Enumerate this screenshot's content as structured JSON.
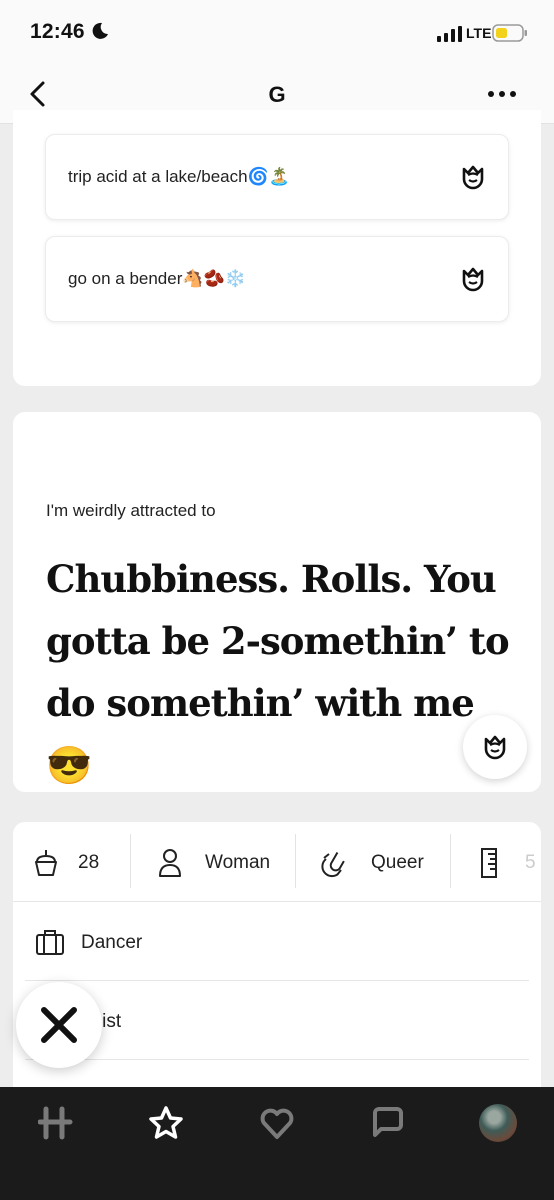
{
  "status_bar": {
    "time": "12:46",
    "network": "LTE"
  },
  "header": {
    "title": "G"
  },
  "answers": [
    {
      "text": "trip acid at a lake/beach🌀🏝️"
    },
    {
      "text": "go on a bender🐴🫘❄️"
    }
  ],
  "prompt": {
    "question": "I'm weirdly attracted to",
    "answer": "Chubbiness. Rolls. You gotta be 2-somethin’ to do somethin’ with me😎"
  },
  "vitals": [
    {
      "icon": "cupcake-icon",
      "label": "28"
    },
    {
      "icon": "person-icon",
      "label": "Woman"
    },
    {
      "icon": "magnet-icon",
      "label": "Queer"
    },
    {
      "icon": "ruler-icon",
      "label": "5"
    }
  ],
  "details": [
    {
      "icon": "briefcase-icon",
      "label": "Dancer"
    },
    {
      "icon": "religion-icon",
      "label": "heist"
    }
  ],
  "nav": [
    "hinge-logo-icon",
    "star-icon",
    "heart-icon",
    "chat-icon",
    "profile-avatar"
  ],
  "colors": {
    "background": "#ededed",
    "card": "#ffffff",
    "nav": "#1b1b1b",
    "battery": "#f2d21b"
  }
}
